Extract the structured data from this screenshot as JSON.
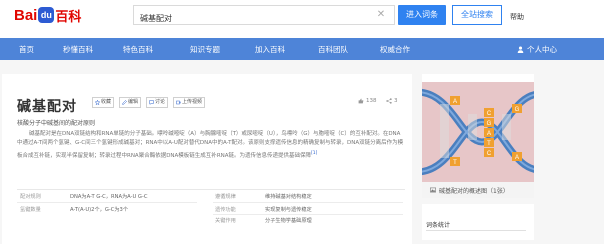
{
  "header": {
    "logo": {
      "part1": "Bai",
      "paw": "du",
      "part2": "百科"
    },
    "search": {
      "value": "碱基配对",
      "placeholder": ""
    },
    "enter_button": "进入词条",
    "search_button": "全站搜索",
    "help": "帮助"
  },
  "nav": {
    "items": [
      "首页",
      "秒懂百科",
      "特色百科",
      "知识专题",
      "加入百科",
      "百科团队",
      "权威合作"
    ],
    "user": "个人中心"
  },
  "article": {
    "title": "碱基配对",
    "tools": [
      "收藏",
      "编辑",
      "讨论",
      "上传视频"
    ],
    "like_count": "138",
    "share_count": "3",
    "subtitle": "核酸分子中碱基间的配对原则",
    "summary": "碱基配对是在DNA双链结构和RNA单链的分子基础。嘌呤碱嘧啶（A）与胸腺嘧啶（T）或尿嘧啶（U），鸟嘌呤（G）与胞嘧啶（C）的互补配对。在DNA中通过A-T间两个氢键、G-C间三个氢键形成碱基对；RNA中以A-U配对替代DNA中的A-T配对。该原则支撑遗传信息的精确复制与转录，DNA双链分离后作为模板合成互补链，实现半保留复制；转录过程中RNA聚合酶依据DNA模板链生成互补RNA链。为遗传信息传递提供基础保障",
    "summary_ref": "[1]",
    "info": [
      {
        "key": "配对规则",
        "value": "DNA为A-T G-C，RNA为A-U G-C"
      },
      {
        "key": "氢键数量",
        "value": "A-T(A-U)2个，G-C为3个"
      },
      {
        "key": "遵循规律",
        "value": "维持碱基对结构稳定"
      },
      {
        "key": "遗传功能",
        "value": "实现复制与遗传稳定"
      },
      {
        "key": "关键作用",
        "value": "分子生物学基础原理"
      }
    ]
  },
  "side": {
    "caption": "碱基配对的概述图（1张）",
    "stats_title": "词条统计",
    "image_letters": [
      "A",
      "T",
      "C",
      "G",
      "A",
      "T",
      "C",
      "G",
      "A",
      "T"
    ]
  },
  "colors": {
    "nav_bg": "#4e84d8",
    "brand_red": "#e10601",
    "accent_blue": "#2f82f0",
    "image_bg": "#e7c6c8",
    "strand": "#4a7fbf",
    "base_orange": "#f0a030"
  }
}
